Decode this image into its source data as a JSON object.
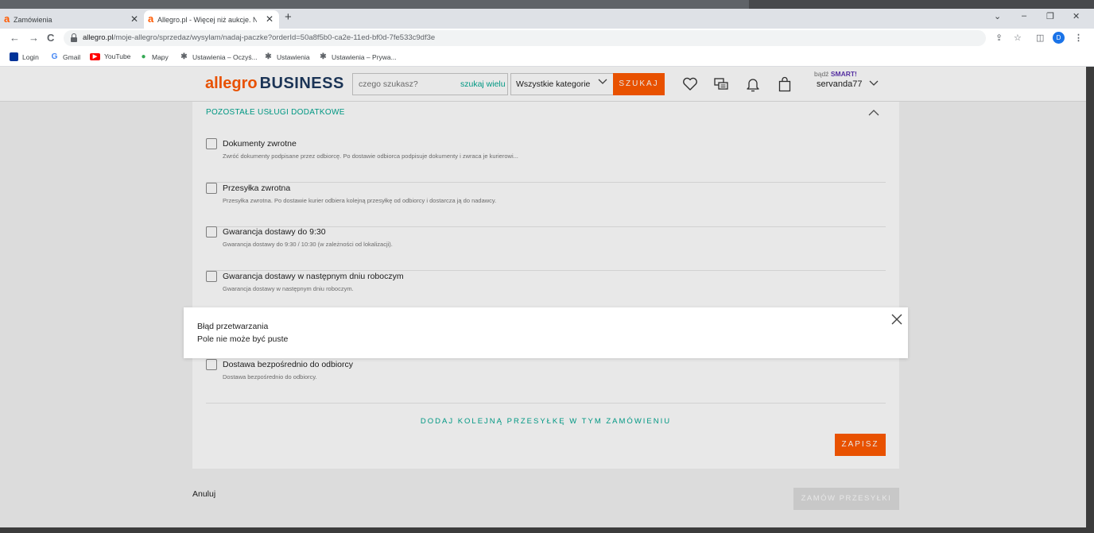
{
  "browser": {
    "tabs": [
      {
        "title": "Zamówienia",
        "favicon": "a"
      },
      {
        "title": "Allegro.pl - Więcej niż aukcje. Na",
        "favicon": "a"
      }
    ],
    "tab_close": "✕",
    "new_tab": "+",
    "window_controls": {
      "chevron": "⌄",
      "minimize": "–",
      "restore": "❐",
      "close": "✕"
    },
    "nav": {
      "back": "←",
      "forward": "→",
      "reload": "C"
    },
    "url_domain": "allegro.pl",
    "url_path": "/moje-allegro/sprzedaz/wysylam/nadaj-paczke?orderId=50a8f5b0-ca2e-11ed-bf0d-7fe533c9df3e",
    "addr_icons": {
      "share": "⇪",
      "star": "☆",
      "sidepanel": "◫",
      "menu": "⋮"
    },
    "profile_initial": "D",
    "bookmarks": [
      {
        "label": "Login",
        "icon": "eu-flag-icon"
      },
      {
        "label": "Gmail",
        "icon": "google-icon"
      },
      {
        "label": "YouTube",
        "icon": "youtube-icon"
      },
      {
        "label": "Mapy",
        "icon": "maps-pin-icon"
      },
      {
        "label": "Ustawienia – Oczyś...",
        "icon": "gear-icon"
      },
      {
        "label": "Ustawienia",
        "icon": "gear-icon"
      },
      {
        "label": "Ustawienia – Prywa...",
        "icon": "gear-icon"
      }
    ]
  },
  "header": {
    "logo_main": "allegro",
    "logo_sub": "BUSINESS",
    "search_placeholder": "czego szukasz?",
    "search_many": "szukaj wielu",
    "category": "Wszystkie kategorie",
    "search_button": "SZUKAJ",
    "smart_prefix": "bądź",
    "smart_label": "SMART!",
    "username": "servanda77"
  },
  "section": {
    "title": "POZOSTAŁE USŁUGI DODATKOWE",
    "options": [
      {
        "label": "Dokumenty zwrotne",
        "desc": "Zwróć dokumenty podpisane przez odbiorcę. Po dostawie odbiorca podpisuje dokumenty i zwraca je kurierowi..."
      },
      {
        "label": "Przesyłka zwrotna",
        "desc": "Przesyłka zwrotna. Po dostawie kurier odbiera kolejną przesyłkę od odbiorcy i dostarcza ją do nadawcy."
      },
      {
        "label": "Gwarancja dostawy do 9:30",
        "desc": "Gwarancja dostawy do 9:30 / 10:30 (w zależności od lokalizacji)."
      },
      {
        "label": "Gwarancja dostawy w następnym dniu roboczym",
        "desc": "Gwarancja dostawy w następnym dniu roboczym."
      },
      {
        "label": "Dostawa bezpośrednio do odbiorcy",
        "desc": "Dostawa bezpośrednio do odbiorcy."
      }
    ],
    "add_more": "DODAJ KOLEJNĄ PRZESYŁKĘ W TYM ZAMÓWIENIU",
    "save": "ZAPISZ"
  },
  "footer": {
    "cancel": "Anuluj",
    "order": "ZAMÓW PRZESYŁKI"
  },
  "modal": {
    "title": "Błąd przetwarzania",
    "message": "Pole nie może być puste",
    "close": "✕"
  },
  "colors": {
    "brand": "#ff5a00",
    "link": "#00a790",
    "business_navy": "#1e3a5f"
  }
}
